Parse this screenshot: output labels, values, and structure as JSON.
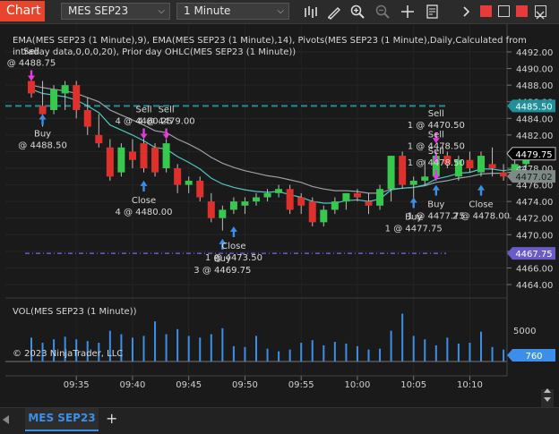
{
  "toolbar": {
    "chart_label": "Chart",
    "instrument": "MES SEP23",
    "interval": "1 Minute"
  },
  "indicators_legend": "EMA(MES SEP23 (1 Minute),9), EMA(MES SEP23 (1 Minute),14), Pivots(MES SEP23 (1 Minute),Daily,Calculated from intraday data,0,0,0,20), Prior day OHLC(MES SEP23 (1 Minute))",
  "volume_legend": "VOL(MES SEP23 (1 Minute))",
  "copyright": "© 2023 NinjaTrader, LLC",
  "tab": {
    "label": "MES SEP23",
    "add": "+"
  },
  "price_axis": {
    "ticks": [
      "4492.00",
      "4490.00",
      "4488.00",
      "4486.00",
      "4484.00",
      "4482.00",
      "4480.00",
      "4478.00",
      "4476.00",
      "4474.00",
      "4472.00",
      "4470.00",
      "4468.00",
      "4466.00",
      "4464.00"
    ],
    "volume_tick": "5000",
    "badges": [
      {
        "text": "4485.50",
        "bg": "#1f8f9a",
        "fg": "#ffffff",
        "kind": "pivot"
      },
      {
        "text": "4479.75",
        "bg": "#000000",
        "fg": "#ffffff",
        "kind": "last"
      },
      {
        "text": "4477.02",
        "bg": "#7f8a86",
        "fg": "#10201a",
        "kind": "ema"
      },
      {
        "text": "4467.75",
        "bg": "#6a5cc8",
        "fg": "#ffffff",
        "kind": "prior-low"
      },
      {
        "text": "760",
        "bg": "#3b8fe8",
        "fg": "#ffffff",
        "kind": "volume"
      }
    ]
  },
  "time_axis": [
    "09:35",
    "09:40",
    "09:45",
    "09:50",
    "09:55",
    "10:00",
    "10:05",
    "10:10"
  ],
  "colors": {
    "up": "#36c94d",
    "down": "#e0302c",
    "ema9": "#4ec7c3",
    "ema14": "#9aa0a6",
    "volume": "#3b8fe8",
    "pivot": "#1f8f9a",
    "prior_low": "#6a5cc8",
    "buy_arrow": "#3b8fe8",
    "sell_arrow": "#e23be0"
  },
  "chart_data": {
    "type": "candlestick",
    "ylim": [
      4462.5,
      4494.5
    ],
    "start_minute": 31,
    "candles": [
      {
        "o": 4488.5,
        "h": 4489.0,
        "l": 4486.5,
        "c": 4487.0
      },
      {
        "o": 4485.5,
        "h": 4488.5,
        "l": 4483.0,
        "c": 4484.5
      },
      {
        "o": 4485.0,
        "h": 4488.0,
        "l": 4484.5,
        "c": 4487.5
      },
      {
        "o": 4487.0,
        "h": 4488.5,
        "l": 4485.0,
        "c": 4488.0
      },
      {
        "o": 4488.0,
        "h": 4488.5,
        "l": 4484.0,
        "c": 4485.0
      },
      {
        "o": 4485.0,
        "h": 4486.5,
        "l": 4482.0,
        "c": 4483.0
      },
      {
        "o": 4482.0,
        "h": 4484.5,
        "l": 4480.5,
        "c": 4481.0
      },
      {
        "o": 4480.5,
        "h": 4481.5,
        "l": 4476.5,
        "c": 4477.0
      },
      {
        "o": 4477.5,
        "h": 4481.0,
        "l": 4477.0,
        "c": 4480.5
      },
      {
        "o": 4480.0,
        "h": 4481.5,
        "l": 4478.0,
        "c": 4479.0
      },
      {
        "o": 4481.0,
        "h": 4482.0,
        "l": 4477.5,
        "c": 4478.0
      },
      {
        "o": 4480.5,
        "h": 4481.0,
        "l": 4477.0,
        "c": 4477.5
      },
      {
        "o": 4478.0,
        "h": 4481.5,
        "l": 4477.5,
        "c": 4481.0
      },
      {
        "o": 4478.0,
        "h": 4478.5,
        "l": 4475.0,
        "c": 4476.0
      },
      {
        "o": 4476.0,
        "h": 4477.0,
        "l": 4475.0,
        "c": 4476.5
      },
      {
        "o": 4476.5,
        "h": 4477.0,
        "l": 4474.0,
        "c": 4474.5
      },
      {
        "o": 4474.0,
        "h": 4475.0,
        "l": 4471.5,
        "c": 4472.0
      },
      {
        "o": 4472.0,
        "h": 4473.5,
        "l": 4470.5,
        "c": 4473.0
      },
      {
        "o": 4473.0,
        "h": 4474.5,
        "l": 4472.5,
        "c": 4474.0
      },
      {
        "o": 4473.5,
        "h": 4474.5,
        "l": 4472.5,
        "c": 4474.0
      },
      {
        "o": 4474.0,
        "h": 4475.0,
        "l": 4473.5,
        "c": 4474.5
      },
      {
        "o": 4474.5,
        "h": 4475.5,
        "l": 4474.0,
        "c": 4475.0
      },
      {
        "o": 4475.0,
        "h": 4476.0,
        "l": 4474.5,
        "c": 4475.5
      },
      {
        "o": 4475.5,
        "h": 4476.0,
        "l": 4472.5,
        "c": 4473.0
      },
      {
        "o": 4474.5,
        "h": 4475.0,
        "l": 4472.5,
        "c": 4473.5
      },
      {
        "o": 4474.0,
        "h": 4474.5,
        "l": 4471.0,
        "c": 4471.5
      },
      {
        "o": 4471.5,
        "h": 4473.5,
        "l": 4471.0,
        "c": 4473.0
      },
      {
        "o": 4473.0,
        "h": 4474.5,
        "l": 4472.5,
        "c": 4474.0
      },
      {
        "o": 4474.0,
        "h": 4475.0,
        "l": 4473.0,
        "c": 4475.0
      },
      {
        "o": 4475.0,
        "h": 4475.5,
        "l": 4474.0,
        "c": 4474.5
      },
      {
        "o": 4474.0,
        "h": 4475.0,
        "l": 4472.5,
        "c": 4473.5
      },
      {
        "o": 4473.5,
        "h": 4476.0,
        "l": 4473.0,
        "c": 4475.5
      },
      {
        "o": 4475.5,
        "h": 4479.5,
        "l": 4474.0,
        "c": 4479.5
      },
      {
        "o": 4479.5,
        "h": 4480.0,
        "l": 4475.5,
        "c": 4476.0
      },
      {
        "o": 4476.0,
        "h": 4477.0,
        "l": 4473.5,
        "c": 4476.5
      },
      {
        "o": 4476.5,
        "h": 4479.0,
        "l": 4476.0,
        "c": 4477.0
      },
      {
        "o": 4477.0,
        "h": 4480.0,
        "l": 4476.5,
        "c": 4479.5
      },
      {
        "o": 4479.5,
        "h": 4480.0,
        "l": 4478.0,
        "c": 4478.5
      },
      {
        "o": 4477.0,
        "h": 4479.5,
        "l": 4476.5,
        "c": 4479.0
      },
      {
        "o": 4479.0,
        "h": 4480.0,
        "l": 4477.5,
        "c": 4478.0
      },
      {
        "o": 4477.5,
        "h": 4480.0,
        "l": 4477.0,
        "c": 4479.5
      },
      {
        "o": 4478.5,
        "h": 4480.5,
        "l": 4477.0,
        "c": 4478.0
      },
      {
        "o": 4477.5,
        "h": 4478.5,
        "l": 4476.5,
        "c": 4477.0
      },
      {
        "o": 4477.0,
        "h": 4479.0,
        "l": 4477.0,
        "c": 4478.5
      },
      {
        "o": 4478.5,
        "h": 4480.0,
        "l": 4478.0,
        "c": 4479.75
      }
    ],
    "ema9": [
      4487.5,
      4487.0,
      4486.8,
      4486.6,
      4486.2,
      4485.5,
      4484.7,
      4483.2,
      4482.6,
      4482.0,
      4481.3,
      4480.5,
      4480.3,
      4479.4,
      4478.7,
      4477.9,
      4476.8,
      4476.1,
      4475.7,
      4475.4,
      4475.2,
      4475.1,
      4475.2,
      4474.8,
      4474.5,
      4474.0,
      4473.8,
      4473.8,
      4474.1,
      4474.2,
      4474.0,
      4474.3,
      4475.4,
      4475.6,
      4475.7,
      4476.0,
      4476.7,
      4477.0,
      4477.4,
      4477.5,
      4477.9,
      4477.9,
      4477.7,
      4477.9,
      4478.3
    ],
    "ema14": [
      4488.0,
      4487.7,
      4487.5,
      4487.3,
      4487.0,
      4486.5,
      4486.0,
      4485.0,
      4484.4,
      4483.8,
      4483.2,
      4482.5,
      4482.3,
      4481.5,
      4480.9,
      4480.2,
      4479.3,
      4478.6,
      4478.1,
      4477.7,
      4477.4,
      4477.1,
      4476.9,
      4476.6,
      4476.3,
      4475.8,
      4475.5,
      4475.3,
      4475.3,
      4475.2,
      4475.0,
      4475.0,
      4475.5,
      4475.6,
      4475.7,
      4475.9,
      4476.3,
      4476.5,
      4476.8,
      4477.0,
      4477.3,
      4477.4,
      4477.4,
      4477.6,
      4477.9
    ],
    "pivot_level": 4485.5,
    "prior_low": 4467.75,
    "volume": [
      2800,
      2200,
      2600,
      2900,
      2600,
      2400,
      2200,
      3600,
      3200,
      2800,
      3000,
      4700,
      3200,
      3800,
      3000,
      2800,
      3200,
      3900,
      1800,
      1700,
      3000,
      1500,
      1200,
      1400,
      2200,
      2500,
      1900,
      2300,
      2100,
      1800,
      1400,
      1500,
      3600,
      5600,
      3000,
      2600,
      1900,
      2800,
      2100,
      2200,
      3500,
      1700,
      1400,
      1200,
      760
    ],
    "vol_max": 6500,
    "buy_markers": [
      {
        "i": 1,
        "price": 4484.5,
        "label": "Buy\n@ 4488.50"
      },
      {
        "i": 10,
        "price": 4476.5,
        "label": "Close\n4 @ 4480.00"
      },
      {
        "i": 17,
        "price": 4469.5,
        "label": "Buy\n3 @ 4469.75"
      },
      {
        "i": 18,
        "price": 4471.0,
        "label": "Close\n1 @ 4473.50"
      },
      {
        "i": 34,
        "price": 4474.5,
        "label": "Buy\n1 @ 4477.75"
      },
      {
        "i": 36,
        "price": 4476.0,
        "label": "Buy\n1 @ 4477.75"
      },
      {
        "i": 40,
        "price": 4476.0,
        "label": "Close\n2 @ 4478.00"
      }
    ],
    "sell_markers": [
      {
        "i": 0,
        "price": 4488.5,
        "label": "Sell\n@ 4488.75"
      },
      {
        "i": 10,
        "price": 4481.5,
        "label": "Sell\n4 @ 4480.25"
      },
      {
        "i": 12,
        "price": 4481.5,
        "label": "Sell\n4 @ 4479.00"
      },
      {
        "i": 36,
        "price": 4481.0,
        "label": "Sell\n1 @ 4470.50"
      },
      {
        "i": 36,
        "price": 4478.5,
        "label": "Sell\n1 @ 4478.50"
      },
      {
        "i": 36,
        "price": 4476.5,
        "label": "Sell\n1 @ 4478.50"
      }
    ]
  }
}
